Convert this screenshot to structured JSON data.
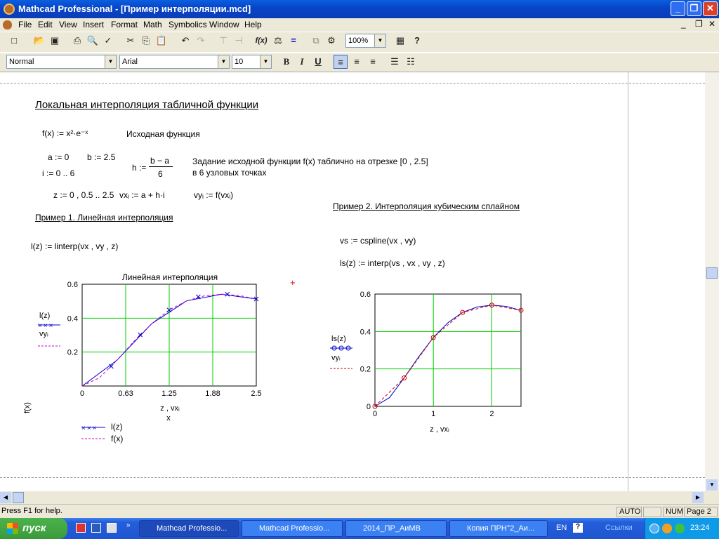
{
  "window": {
    "title": "Mathcad Professional - [Пример интерполяции.mcd]"
  },
  "menu": [
    "File",
    "Edit",
    "View",
    "Insert",
    "Format",
    "Math",
    "Symbolics",
    "Window",
    "Help"
  ],
  "toolbar": {
    "zoom": "100%"
  },
  "format": {
    "style": "Normal",
    "font": "Arial",
    "size": "10"
  },
  "doc": {
    "heading": "Локальная интерполяция табличной функции",
    "f_def": "f(x) := x²·e⁻ˣ",
    "f_note": "Исходная функция",
    "a_def": "a := 0",
    "b_def": "b := 2.5",
    "i_def": "i := 0 .. 6",
    "h_lhs": "h :=",
    "h_num": "b − a",
    "h_den": "6",
    "task_note1": "Задание исходной функции f(x) таблично на отрезке [0 , 2.5]",
    "task_note2": "в 6 узловых точках",
    "z_def": "z := 0 , 0.5 .. 2.5",
    "vx_def": "vxᵢ := a + h·i",
    "vy_def": "vyᵢ := f(vxᵢ)",
    "ex1_title": "Пример 1. Линейная интерполяция",
    "l_def": "l(z) := linterp(vx , vy , z)",
    "ex2_title": "Пример 2. Интерполяция кубическим сплайном",
    "vs_def": "vs := cspline(vx , vy)",
    "ls_def": "ls(z) := interp(vs , vx , vy , z)"
  },
  "chart_data": [
    {
      "type": "line",
      "title": "Линейная интерполяция",
      "xlabel": "z , vxᵢ",
      "xlabel2": "x",
      "ylabel": "f(x)",
      "xlim": [
        0,
        2.5
      ],
      "ylim": [
        0,
        0.6
      ],
      "xticks": [
        "0",
        "0.63",
        "1.25",
        "1.88",
        "2.5"
      ],
      "yticks": [
        "0.2",
        "0.4",
        "0.6"
      ],
      "ylabels_left": [
        "l(z)",
        "vyᵢ"
      ],
      "legend": [
        "l(z)",
        "f(x)"
      ],
      "series": [
        {
          "name": "l(z)",
          "x": [
            0,
            0.5,
            1.0,
            1.5,
            2.0,
            2.5
          ],
          "y": [
            0,
            0.152,
            0.368,
            0.502,
            0.541,
            0.513
          ]
        },
        {
          "name": "f(x)",
          "x": [
            0,
            0.25,
            0.5,
            0.75,
            1.0,
            1.25,
            1.5,
            1.75,
            2.0,
            2.25,
            2.5
          ],
          "y": [
            0,
            0.049,
            0.152,
            0.266,
            0.368,
            0.448,
            0.502,
            0.531,
            0.541,
            0.534,
            0.513
          ]
        }
      ],
      "markers_x": [
        0.4167,
        0.8333,
        1.25,
        1.6667,
        2.0833,
        2.5
      ],
      "markers_y": [
        0.116,
        0.302,
        0.448,
        0.526,
        0.541,
        0.513
      ]
    },
    {
      "type": "line",
      "xlabel": "z , vxᵢ",
      "xlim": [
        0,
        2.5
      ],
      "ylim": [
        0,
        0.6
      ],
      "xticks": [
        "0",
        "1",
        "2"
      ],
      "yticks": [
        "0",
        "0.2",
        "0.4",
        "0.6"
      ],
      "ylabels_left": [
        "ls(z)",
        "vyᵢ"
      ],
      "series": [
        {
          "name": "ls(z)",
          "x": [
            0,
            0.25,
            0.5,
            0.75,
            1.0,
            1.25,
            1.5,
            1.75,
            2.0,
            2.25,
            2.5
          ],
          "y": [
            0,
            0.047,
            0.152,
            0.265,
            0.368,
            0.447,
            0.502,
            0.531,
            0.541,
            0.534,
            0.513
          ]
        },
        {
          "name": "vy",
          "x": [
            0,
            0.5,
            1.0,
            1.5,
            2.0,
            2.5
          ],
          "y": [
            0,
            0.152,
            0.368,
            0.502,
            0.541,
            0.513
          ]
        }
      ]
    }
  ],
  "status": {
    "help": "Press F1 for help.",
    "auto": "AUTO",
    "num": "NUM",
    "page": "Page 2"
  },
  "taskbar": {
    "start": "пуск",
    "tasks": [
      "Mathcad Professio...",
      "Mathcad Professio...",
      "2014_ПР_АиМВ",
      "Копия ПРН°2_Аи..."
    ],
    "lang": "EN",
    "links": "Ссылки",
    "time": "23:24"
  }
}
